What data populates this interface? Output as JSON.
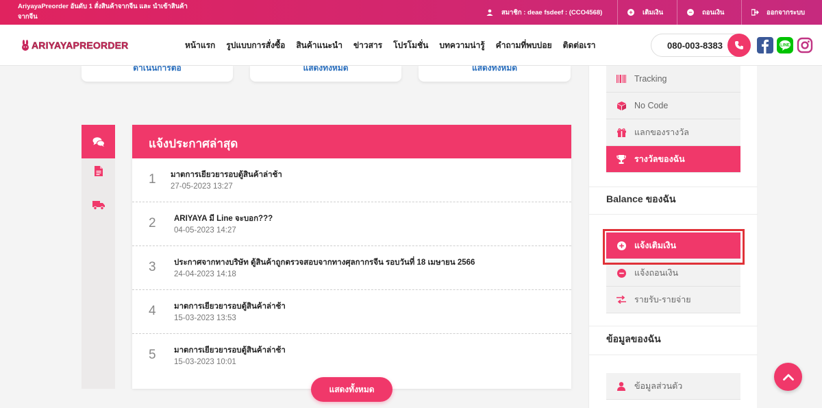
{
  "topbar": {
    "tagline": "AriyayaPreorder อันดับ 1 สั่งสินค้าจากจีน และ นำเข้าสินค้าจากจีน",
    "member": "สมาชิก : deae fsdeef : (CCO4568)",
    "deposit": "เติมเงิน",
    "withdraw": "ถอนเงิน",
    "logout": "ออกจากระบบ"
  },
  "header": {
    "logo_text": "ARIYAYAPREORDER",
    "nav": [
      "หน้าแรก",
      "รูปแบบการสั่งซื้อ",
      "สินค้าแนะนำ",
      "ข่าวสาร",
      "โปรโมชั่น",
      "บทความน่ารู้",
      "คำถามที่พบบ่อย",
      "ติดต่อเรา"
    ],
    "phone": "080-003-8383"
  },
  "cards_top": [
    "ดำเนินการต่อ",
    "แสดงทั้งหมด",
    "แสดงทั้งหมด"
  ],
  "announcements": {
    "title": "แจ้งประกาศล่าสุด",
    "items": [
      {
        "index": "1",
        "title": "มาตการเยียวยารอบตู้สินค้าล่าช้า",
        "date": "27-05-2023 13:27"
      },
      {
        "index": "2",
        "title": "ARIYAYA มี Line จะบอก???",
        "date": "04-05-2023 14:27"
      },
      {
        "index": "3",
        "title": "ประกาศจากทางบริษัท ตู้สินค้าถูกตรวจสอบจากทางศุลกากรจีน รอบวันที่ 18 เมษายน 2566",
        "date": "24-04-2023 14:18"
      },
      {
        "index": "4",
        "title": "มาตการเยียวยารอบตู้สินค้าล่าช้า",
        "date": "15-03-2023 13:53"
      },
      {
        "index": "5",
        "title": "มาตการเยียวยารอบตู้สินค้าล่าช้า",
        "date": "15-03-2023 10:01"
      }
    ],
    "show_all": "แสดงทั้งหมด"
  },
  "sidebar": {
    "menu1": [
      "Tracking",
      "No Code",
      "แลกของรางวัล",
      "รางวัลของฉัน"
    ],
    "balance_title": "Balance ของฉัน",
    "balance_menu": [
      "แจ้งเติมเงิน",
      "แจ้งถอนเงิน",
      "รายรับ-รายจ่าย"
    ],
    "info_title": "ข้อมูลของฉัน",
    "info_menu": [
      "ข้อมูลส่วนตัว"
    ]
  },
  "colors": {
    "accent": "#f0386a",
    "highlight": "#e03238"
  }
}
